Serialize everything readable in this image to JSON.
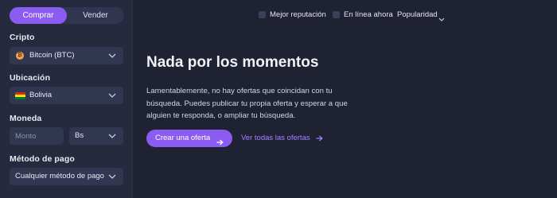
{
  "sidebar": {
    "toggle": {
      "buy_label": "Comprar",
      "sell_label": "Vender",
      "active": "buy"
    },
    "crypto": {
      "label": "Cripto",
      "value": "Bitcoin (BTC)",
      "icon": "bitcoin-icon"
    },
    "location": {
      "label": "Ubicación",
      "value": "Bolivia",
      "icon": "bolivia-flag-icon"
    },
    "currency": {
      "label": "Moneda",
      "amount_placeholder": "Monto",
      "currency_value": "Bs"
    },
    "payment": {
      "label": "Método de pago",
      "value": "Cualquier método de pago"
    }
  },
  "filters": {
    "best_reputation": {
      "label": "Mejor reputación",
      "checked": false
    },
    "online_now": {
      "label": "En línea ahora",
      "checked": false
    },
    "sort": {
      "label": "Popularidad"
    }
  },
  "empty_state": {
    "title": "Nada por los momentos",
    "description": "Lamentablemente, no hay ofertas que coincidan con tu búsqueda. Puedes publicar tu propia oferta y esperar a que alguien te responda, o ampliar tu búsqueda.",
    "create_offer_label": "Crear una oferta",
    "see_all_label": "Ver todas las ofertas"
  },
  "colors": {
    "background": "#1f2233",
    "sidebar": "#262a3e",
    "accent": "#8c5cf2",
    "link": "#a980ff"
  }
}
